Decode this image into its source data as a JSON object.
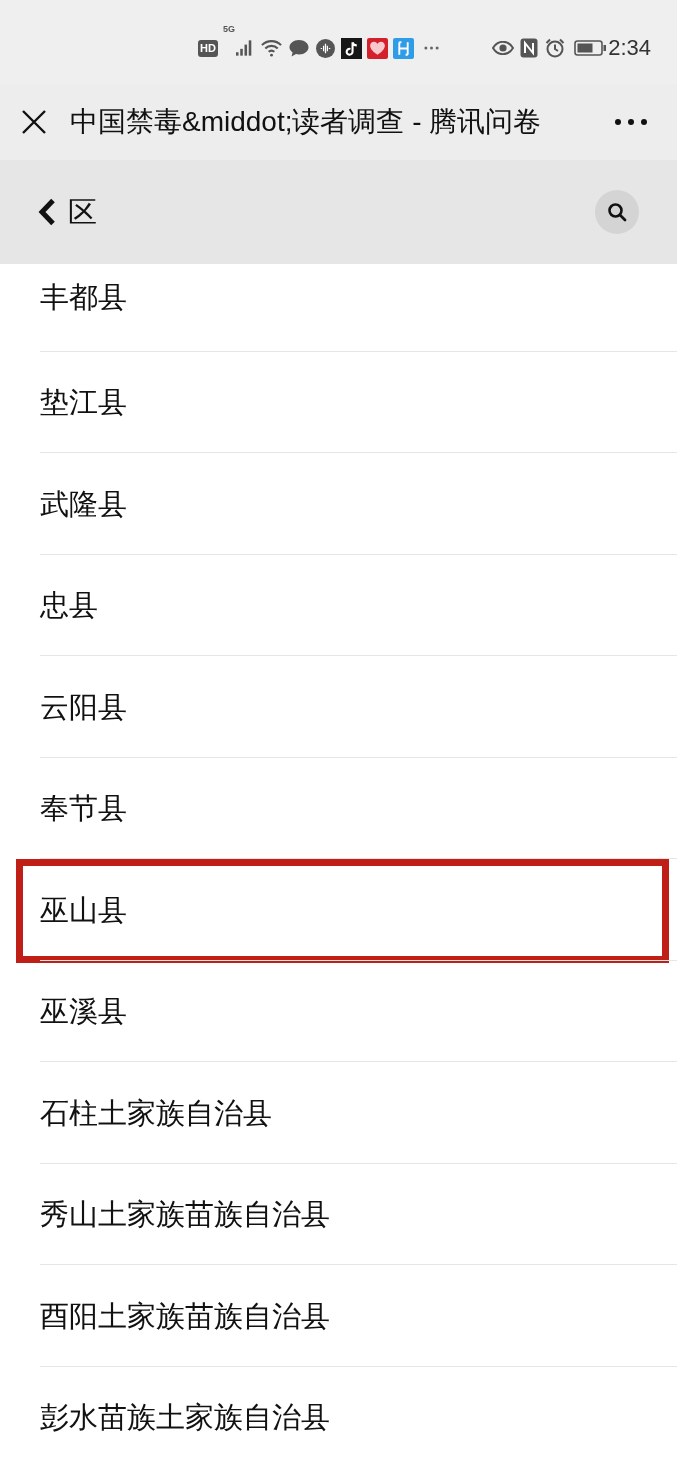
{
  "status_bar": {
    "hd_label": "HD",
    "network_label": "5G",
    "time": "2:34"
  },
  "title_bar": {
    "title": "中国禁毒&middot;读者调查 - 腾讯问卷"
  },
  "header": {
    "title": "区"
  },
  "list": {
    "items": [
      {
        "label": "丰都县",
        "highlighted": false
      },
      {
        "label": "垫江县",
        "highlighted": false
      },
      {
        "label": "武隆县",
        "highlighted": false
      },
      {
        "label": "忠县",
        "highlighted": false
      },
      {
        "label": "云阳县",
        "highlighted": false
      },
      {
        "label": "奉节县",
        "highlighted": false
      },
      {
        "label": "巫山县",
        "highlighted": true
      },
      {
        "label": "巫溪县",
        "highlighted": false
      },
      {
        "label": "石柱土家族自治县",
        "highlighted": false
      },
      {
        "label": "秀山土家族苗族自治县",
        "highlighted": false
      },
      {
        "label": "酉阳土家族苗族自治县",
        "highlighted": false
      },
      {
        "label": "彭水苗族土家族自治县",
        "highlighted": false
      }
    ]
  }
}
